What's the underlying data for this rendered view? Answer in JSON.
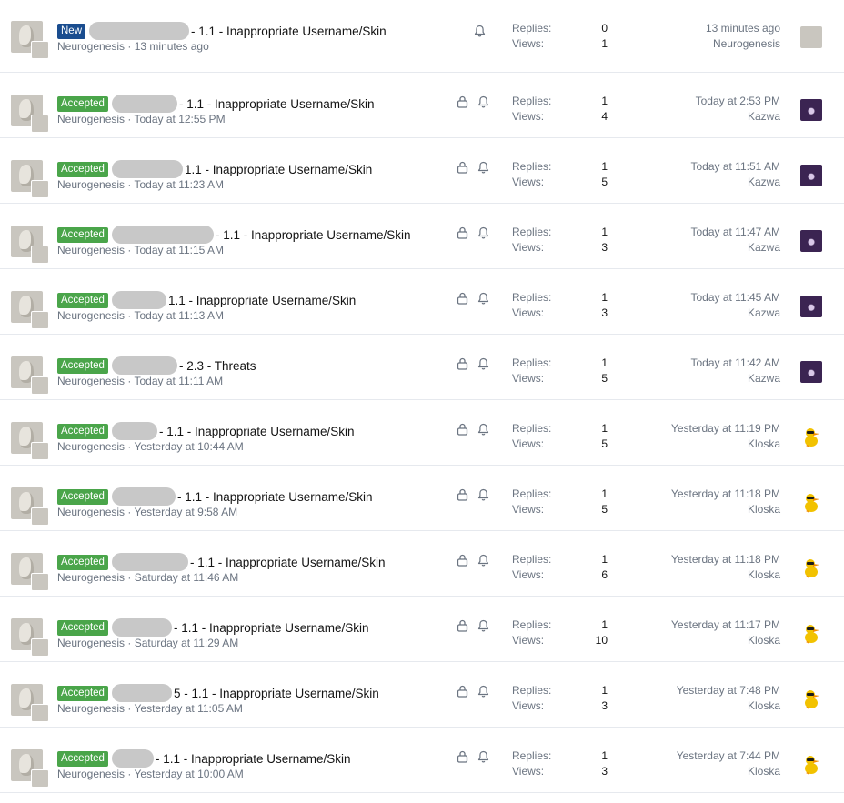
{
  "threads": [
    {
      "badge": "New",
      "badge_type": "new",
      "title": "- 1.1 - Inappropriate Username/Skin",
      "redact_width": 110,
      "author": "Neurogenesis",
      "started": "13 minutes ago",
      "locked": false,
      "replies_label": "Replies:",
      "replies": "0",
      "views_label": "Views:",
      "views": "1",
      "last_time": "13 minutes ago",
      "last_user": "Neurogenesis",
      "last_avatar": "neuro"
    },
    {
      "badge": "Accepted",
      "badge_type": "accepted",
      "title": "- 1.1 - Inappropriate Username/Skin",
      "redact_width": 72,
      "author": "Neurogenesis",
      "started": "Today at 12:55 PM",
      "locked": true,
      "replies_label": "Replies:",
      "replies": "1",
      "views_label": "Views:",
      "views": "4",
      "last_time": "Today at 2:53 PM",
      "last_user": "Kazwa",
      "last_avatar": "kazwa"
    },
    {
      "badge": "Accepted",
      "badge_type": "accepted",
      "title": "1.1 - Inappropriate Username/Skin",
      "redact_width": 78,
      "author": "Neurogenesis",
      "started": "Today at 11:23 AM",
      "locked": true,
      "replies_label": "Replies:",
      "replies": "1",
      "views_label": "Views:",
      "views": "5",
      "last_time": "Today at 11:51 AM",
      "last_user": "Kazwa",
      "last_avatar": "kazwa"
    },
    {
      "badge": "Accepted",
      "badge_type": "accepted",
      "title": "- 1.1 - Inappropriate Username/Skin",
      "redact_width": 112,
      "author": "Neurogenesis",
      "started": "Today at 11:15 AM",
      "locked": true,
      "replies_label": "Replies:",
      "replies": "1",
      "views_label": "Views:",
      "views": "3",
      "last_time": "Today at 11:47 AM",
      "last_user": "Kazwa",
      "last_avatar": "kazwa"
    },
    {
      "badge": "Accepted",
      "badge_type": "accepted",
      "title": "1.1 - Inappropriate Username/Skin",
      "redact_width": 60,
      "author": "Neurogenesis",
      "started": "Today at 11:13 AM",
      "locked": true,
      "replies_label": "Replies:",
      "replies": "1",
      "views_label": "Views:",
      "views": "3",
      "last_time": "Today at 11:45 AM",
      "last_user": "Kazwa",
      "last_avatar": "kazwa"
    },
    {
      "badge": "Accepted",
      "badge_type": "accepted",
      "title": "- 2.3 - Threats",
      "redact_width": 72,
      "author": "Neurogenesis",
      "started": "Today at 11:11 AM",
      "locked": true,
      "replies_label": "Replies:",
      "replies": "1",
      "views_label": "Views:",
      "views": "5",
      "last_time": "Today at 11:42 AM",
      "last_user": "Kazwa",
      "last_avatar": "kazwa"
    },
    {
      "badge": "Accepted",
      "badge_type": "accepted",
      "title": "- 1.1 - Inappropriate Username/Skin",
      "redact_width": 50,
      "author": "Neurogenesis",
      "started": "Yesterday at 10:44 AM",
      "locked": true,
      "replies_label": "Replies:",
      "replies": "1",
      "views_label": "Views:",
      "views": "5",
      "last_time": "Yesterday at 11:19 PM",
      "last_user": "Kloska",
      "last_avatar": "kloska"
    },
    {
      "badge": "Accepted",
      "badge_type": "accepted",
      "title": "- 1.1 - Inappropriate Username/Skin",
      "redact_width": 70,
      "author": "Neurogenesis",
      "started": "Yesterday at 9:58 AM",
      "locked": true,
      "replies_label": "Replies:",
      "replies": "1",
      "views_label": "Views:",
      "views": "5",
      "last_time": "Yesterday at 11:18 PM",
      "last_user": "Kloska",
      "last_avatar": "kloska"
    },
    {
      "badge": "Accepted",
      "badge_type": "accepted",
      "title": "- 1.1 - Inappropriate Username/Skin",
      "redact_width": 84,
      "author": "Neurogenesis",
      "started": "Saturday at 11:46 AM",
      "locked": true,
      "replies_label": "Replies:",
      "replies": "1",
      "views_label": "Views:",
      "views": "6",
      "last_time": "Yesterday at 11:18 PM",
      "last_user": "Kloska",
      "last_avatar": "kloska"
    },
    {
      "badge": "Accepted",
      "badge_type": "accepted",
      "title": "- 1.1 - Inappropriate Username/Skin",
      "redact_width": 66,
      "author": "Neurogenesis",
      "started": "Saturday at 11:29 AM",
      "locked": true,
      "replies_label": "Replies:",
      "replies": "1",
      "views_label": "Views:",
      "views": "10",
      "last_time": "Yesterday at 11:17 PM",
      "last_user": "Kloska",
      "last_avatar": "kloska"
    },
    {
      "badge": "Accepted",
      "badge_type": "accepted",
      "title": "5 - 1.1 - Inappropriate Username/Skin",
      "redact_width": 66,
      "author": "Neurogenesis",
      "started": "Yesterday at 11:05 AM",
      "locked": true,
      "replies_label": "Replies:",
      "replies": "1",
      "views_label": "Views:",
      "views": "3",
      "last_time": "Yesterday at 7:48 PM",
      "last_user": "Kloska",
      "last_avatar": "kloska"
    },
    {
      "badge": "Accepted",
      "badge_type": "accepted",
      "title": "- 1.1 - Inappropriate Username/Skin",
      "redact_width": 46,
      "author": "Neurogenesis",
      "started": "Yesterday at 10:00 AM",
      "locked": true,
      "replies_label": "Replies:",
      "replies": "1",
      "views_label": "Views:",
      "views": "3",
      "last_time": "Yesterday at 7:44 PM",
      "last_user": "Kloska",
      "last_avatar": "kloska"
    }
  ],
  "colors": {
    "accepted": "#4aa54a",
    "new": "#1a4d8f",
    "meta": "#6b7481",
    "divider": "#e6e9ee"
  },
  "icons": {
    "lock": "lock-icon",
    "bell": "bell-icon"
  }
}
